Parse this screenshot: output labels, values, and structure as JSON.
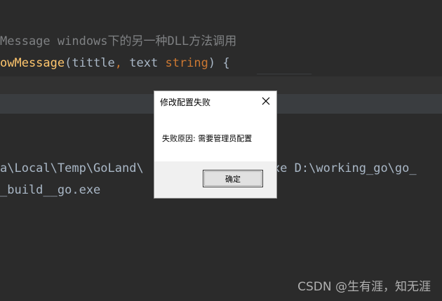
{
  "editor": {
    "comment_line": "Message windows下的另一种DLL方法调用",
    "func_name": "owMessage",
    "func_params_open": "(tittle",
    "comma": ",",
    "param_text": " text ",
    "param_type": "string",
    "func_close": ") {",
    "output_line1": "a\\Local\\Temp\\GoLand\\                .exe D:\\working_go\\go_",
    "output_line2": "_build__go.exe"
  },
  "dialog": {
    "title": "修改配置失败",
    "message": "失败原因: 需要管理员配置",
    "ok_label": "确定",
    "close_icon": "close-icon"
  },
  "watermark": {
    "text": "CSDN @生有涯，知无涯"
  },
  "colors": {
    "editor_bg": "#2b2b2b",
    "comment": "#7f8183",
    "function": "#ffc66d",
    "keyword": "#cc7832",
    "text": "#a9b7c6",
    "dialog_footer": "#f0f0f0"
  }
}
